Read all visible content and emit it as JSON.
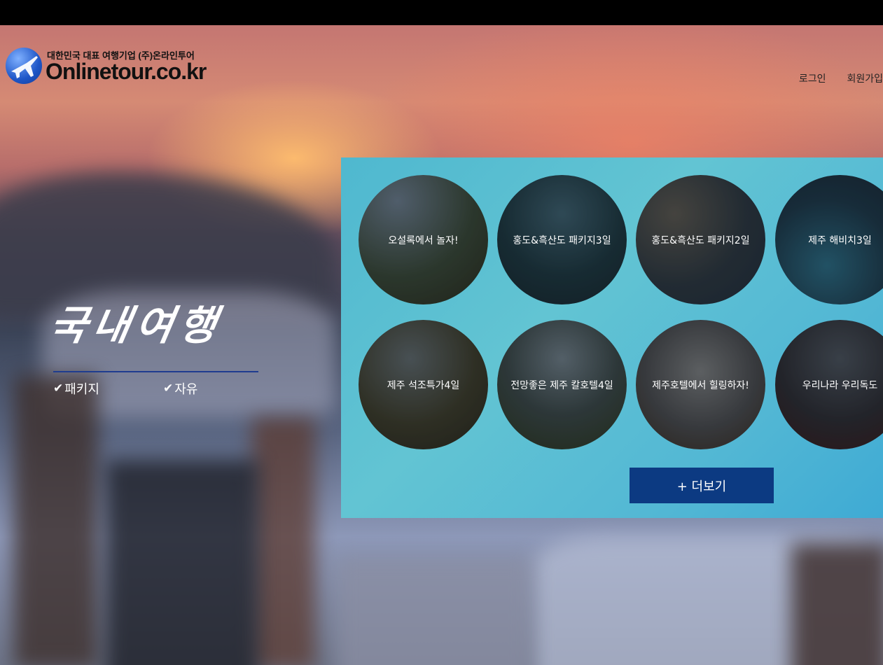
{
  "header": {
    "logo_tagline": "대한민국 대표 여행기업 (주)온라인투어",
    "logo_name": "Onlinetour.co.kr",
    "nav": {
      "login": "로그인",
      "signup": "회원가입"
    }
  },
  "hero": {
    "title": "국내여행",
    "filters": [
      {
        "label": "패키지"
      },
      {
        "label": "자유"
      }
    ]
  },
  "products": [
    {
      "label": "오설록에서 놀자!"
    },
    {
      "label": "홍도&흑산도 패키지3일"
    },
    {
      "label": "홍도&흑산도 패키지2일"
    },
    {
      "label": "제주 해비치3일"
    },
    {
      "label": "제주 석조특가4일"
    },
    {
      "label": "전망좋은 제주 칼호텔4일"
    },
    {
      "label": "제주호텔에서 힐링하자!"
    },
    {
      "label": "우리나라 우리독도"
    }
  ],
  "more_button": {
    "label": "+ 더보기"
  },
  "colors": {
    "panel": "#52b7d4",
    "button": "#0c3a82",
    "title_line": "#1f3c8f"
  }
}
